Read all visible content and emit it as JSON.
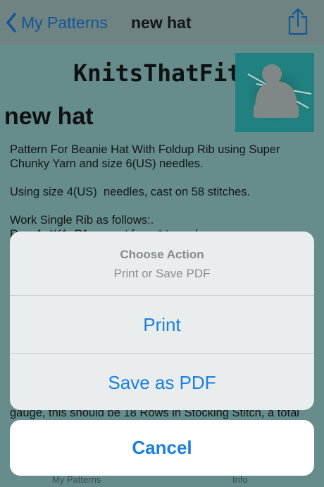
{
  "nav": {
    "back_label": "My Patterns",
    "title": "new hat"
  },
  "content": {
    "brand": "KnitsThatFit",
    "pattern_title": "new hat",
    "pattern_text": "Pattern For Beanie Hat With Foldup Rib using Super Chunky Yarn and size 6(US) needles.\n\nUsing size 4(US)  needles, cast on 58 stitches.\n\nWork Single Rib as follows:.\nRow 1: *K1, P1, repeat from * to end.",
    "pattern_text_lower": "gauge, this should be 18 Rows in Stocking Stitch, a total"
  },
  "tabs": {
    "patterns": "My Patterns",
    "info": "Info"
  },
  "sheet": {
    "title": "Choose Action",
    "message": "Print or Save PDF",
    "print_label": "Print",
    "save_pdf_label": "Save as PDF",
    "cancel_label": "Cancel"
  },
  "colors": {
    "accent": "#1a7fe0",
    "logo_bg": "#1b8d8d"
  }
}
